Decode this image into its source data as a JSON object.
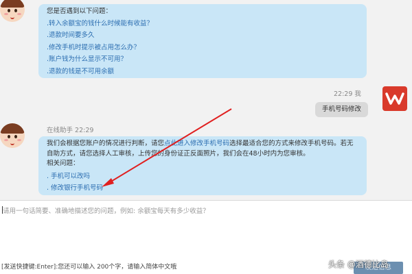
{
  "messages": {
    "first": {
      "title": "您是否遇到以下问题：",
      "links": [
        ".转入余额宝的钱什么时候能有收益？",
        ".退款时间要多久",
        ".修改手机时提示被占用怎么办？",
        ".账户钱为什么显示不可用？",
        ".退款的钱是不可用余额"
      ]
    },
    "user": {
      "time": "22:29",
      "sender": "我",
      "text": "手机号码修改"
    },
    "reply": {
      "sender": "在线助手",
      "time": "22:29",
      "line1_a": "我们会根据您账户的情况进行判断，请您",
      "line1_link": "点此进入修改手机号码",
      "line1_b": "选择最适合您的方式来修改手机号码。若无",
      "line2": "自助方式，请您选择人工审核，上传您的身份证正反面照片，我们会在48小时内为您审核。",
      "line3": "相关问题：",
      "links": [
        ". 手机可以改吗",
        ". 修改银行手机号码"
      ]
    }
  },
  "input": {
    "placeholder": "请用一句话简要、准确地描述您的问题，例如: 余额宝每天有多少收益？"
  },
  "footer": {
    "hint": "[发送快捷键:Enter]:您还可以输入 200个字，请输入简体中文哦",
    "send_label": "发送信息",
    "watermark": "头条 @酒德比岛"
  },
  "colors": {
    "bubble_left": "#c9e6f7",
    "bubble_right": "#d9d9d9",
    "link": "#2b6db0",
    "arrow": "#e02020",
    "wps_icon": "#d93a2b"
  }
}
